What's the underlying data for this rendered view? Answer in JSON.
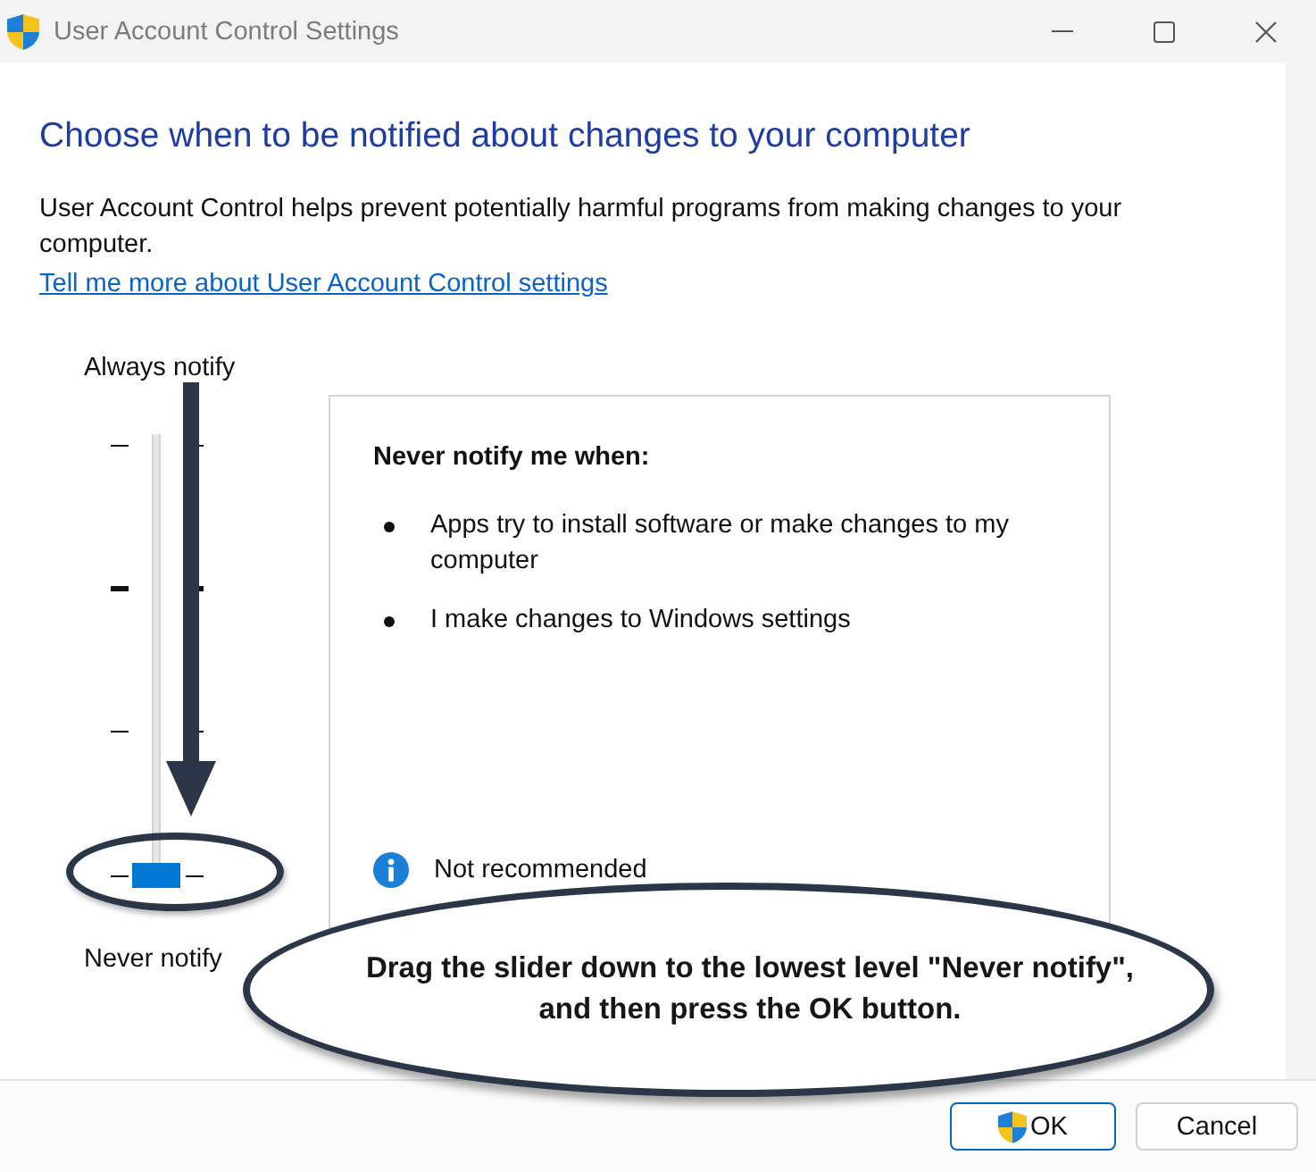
{
  "window": {
    "title": "User Account Control Settings"
  },
  "heading": "Choose when to be notified about changes to your computer",
  "description": "User Account Control helps prevent potentially harmful programs from making changes to your computer.",
  "link": "Tell me more about User Account Control settings",
  "slider": {
    "top_label": "Always notify",
    "bottom_label": "Never notify",
    "level": 0,
    "ticks": [
      {
        "bold": false
      },
      {
        "bold": true
      },
      {
        "bold": false
      },
      {
        "bold": false
      }
    ]
  },
  "info_panel": {
    "title": "Never notify me when:",
    "items": [
      "Apps try to install software or make changes to my computer",
      "I make changes to Windows settings"
    ],
    "note": "Not recommended"
  },
  "annotation": {
    "text": "Drag the slider down to the lowest level \"Never notify\", and then press the OK button."
  },
  "buttons": [
    {
      "label": "OK",
      "kind": "elevated",
      "default": true
    },
    {
      "label": "Cancel",
      "kind": "plain",
      "default": false
    }
  ]
}
